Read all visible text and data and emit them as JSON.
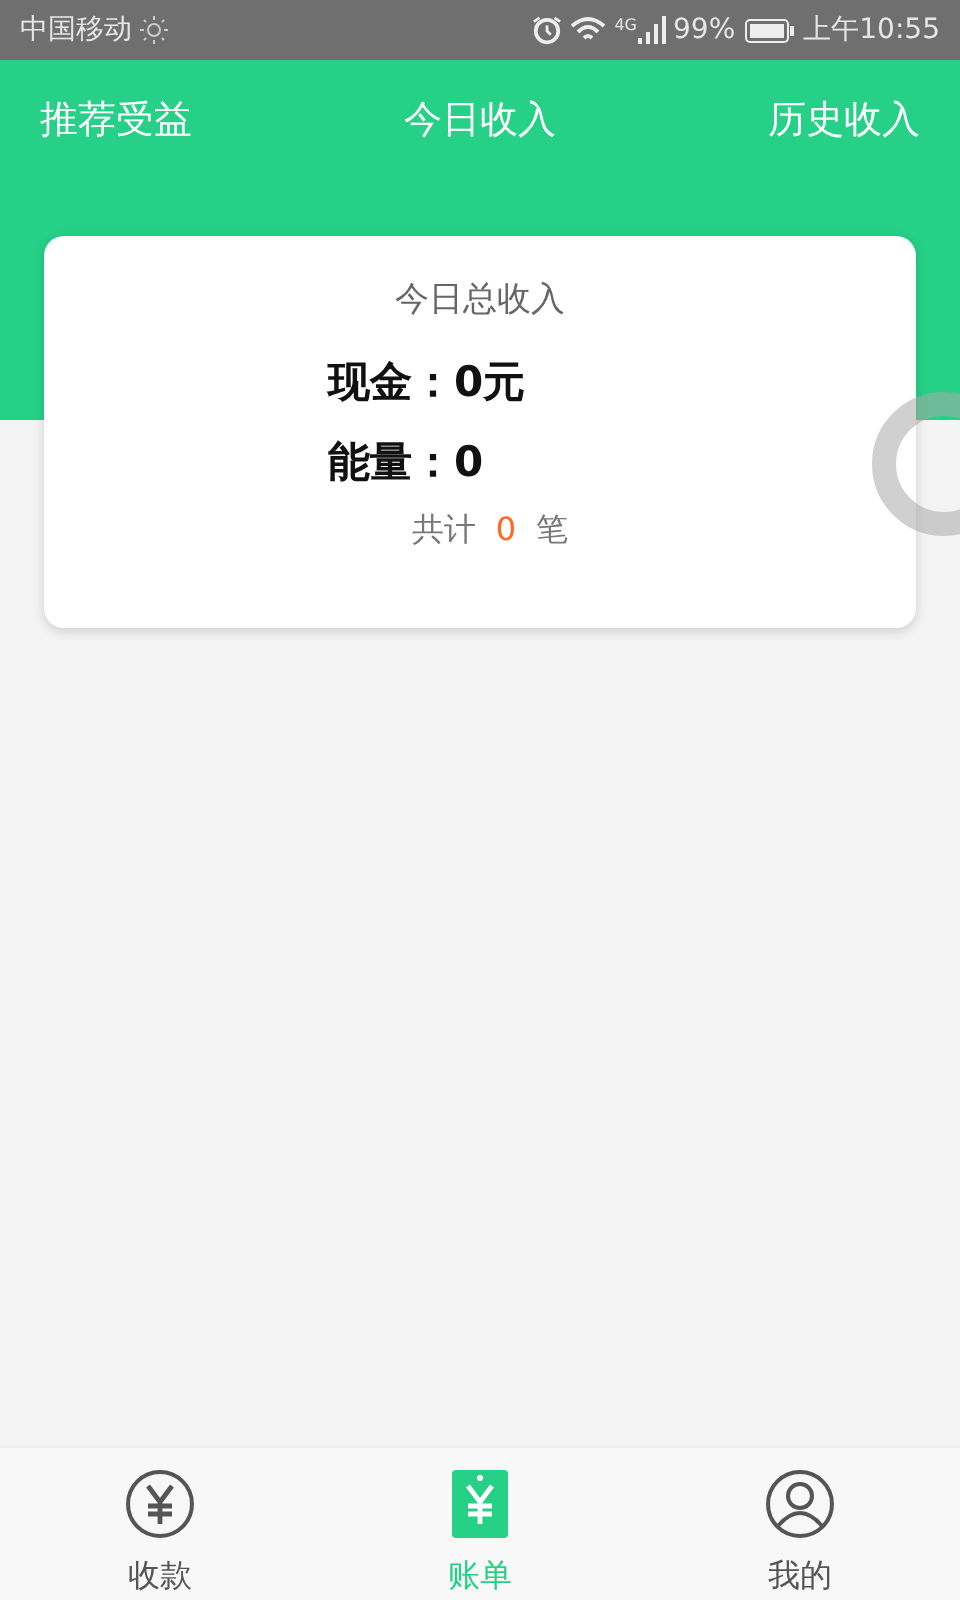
{
  "status_bar": {
    "carrier": "中国移动",
    "network": "4G",
    "battery": "99%",
    "time": "上午10:55"
  },
  "header": {
    "left": "推荐受益",
    "title": "今日收入",
    "right": "历史收入"
  },
  "summary": {
    "title": "今日总收入",
    "cash_label": "现金：",
    "cash_value": "0元",
    "energy_label": "能量：",
    "energy_value": "0",
    "count_prefix": "共计",
    "count": "0",
    "count_suffix": "笔"
  },
  "tabs": [
    {
      "label": "收款",
      "kind": "yen-circle",
      "selected": false
    },
    {
      "label": "账单",
      "kind": "yen-tag",
      "selected": true
    },
    {
      "label": "我的",
      "kind": "person",
      "selected": false
    }
  ]
}
